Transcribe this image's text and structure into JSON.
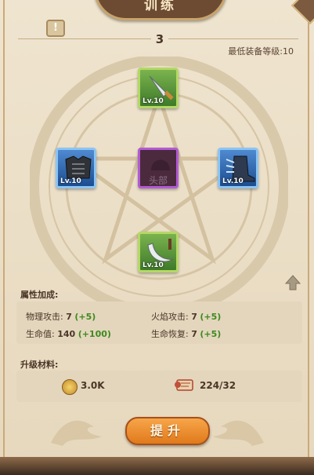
{
  "header": {
    "title": "训练"
  },
  "info": {
    "label": "!"
  },
  "level": {
    "value": "3",
    "min_equip_level": "最低装备等级:10"
  },
  "slots": {
    "top": {
      "level": "Lv.10",
      "icon": "dagger-icon"
    },
    "left": {
      "level": "Lv.10",
      "icon": "armor-icon"
    },
    "center": {
      "label": "头部",
      "icon": "helmet-icon"
    },
    "right": {
      "level": "Lv.10",
      "icon": "boots-icon"
    },
    "bottom": {
      "level": "Lv.10",
      "icon": "scimitar-icon"
    }
  },
  "attributes": {
    "title": "属性加成:",
    "items": [
      {
        "label": "物理攻击:",
        "value": "7",
        "bonus": "(+5)"
      },
      {
        "label": "火焰攻击:",
        "value": "7",
        "bonus": "(+5)"
      },
      {
        "label": "生命值:",
        "value": "140",
        "bonus": "(+100)"
      },
      {
        "label": "生命恢复:",
        "value": "7",
        "bonus": "(+5)"
      }
    ]
  },
  "materials": {
    "title": "升级材料:",
    "coin": "3.0K",
    "scroll": "224/32"
  },
  "upgrade_button": "提升",
  "colors": {
    "bonus": "#3f8a1e",
    "button": "#e98a2a",
    "panel": "#ece0c8"
  }
}
